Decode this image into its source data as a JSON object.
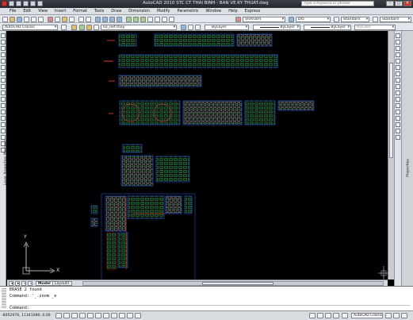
{
  "window": {
    "title": "AutoCAD 2010   STC CT THAI BINH - BAN VE KY THUAT.dwg",
    "search_placeholder": "Type a keyword or phrase",
    "minimize": "–",
    "maximize": "□",
    "close": "×"
  },
  "menu": {
    "items": [
      "File",
      "Edit",
      "View",
      "Insert",
      "Format",
      "Tools",
      "Draw",
      "Dimension",
      "Modify",
      "Parametric",
      "Window",
      "Help",
      "Express"
    ]
  },
  "toolbar1": {
    "text_style_label": "VnArialH",
    "dim_style_label": "DI5",
    "table_style_label": "Standard",
    "multileader_style_label": "Standard"
  },
  "toolbar2": {
    "workspace": "AutoCAD Classic",
    "layer": "02_net thay",
    "color": "ByLayer",
    "linetype": "ByLayer",
    "lineweight": "ByLayer",
    "plotstyle": "ByColor"
  },
  "side_panels": {
    "left_label": "Layer Properties Manager",
    "right_label": "Properties"
  },
  "layout_tabs": {
    "model": "Model",
    "layout1": "Layout1"
  },
  "ucs": {
    "y": "Y",
    "x": "X"
  },
  "command_line": {
    "history": [
      "ERASE 2 found",
      "Command: '_.zoom _e"
    ],
    "prompt": "Command:"
  },
  "status_bar": {
    "coordinates": "-8052976, 11341080, 0.00",
    "workspace": "AutoCAD Classic"
  },
  "colors": {
    "canvas": "#000000",
    "sheet_frame_blue": "#1d3b8a",
    "sheet_frame_red": "#c0332c",
    "linework_green": "#36c24a",
    "linework_cyan": "#38c7d6",
    "linework_white": "#e8e8e8"
  },
  "icons": {
    "app": "autocad-logo-icon",
    "quick_access": [
      "new-icon",
      "open-icon",
      "save-icon",
      "undo-icon",
      "redo-icon"
    ],
    "search": "binoculars-icon",
    "ucs": "ucs-axis-icon"
  }
}
